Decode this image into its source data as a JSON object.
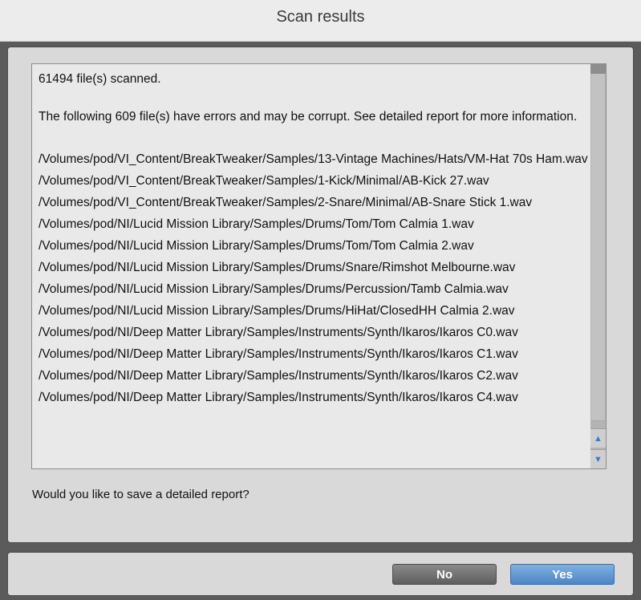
{
  "window": {
    "title": "Scan results"
  },
  "results": {
    "summary": "61494 file(s) scanned.",
    "error_message": "The following 609 file(s) have errors and may be corrupt. See detailed report for more information.",
    "files": [
      "/Volumes/pod/VI_Content/BreakTweaker/Samples/13-Vintage Machines/Hats/VM-Hat 70s Ham.wav",
      "/Volumes/pod/VI_Content/BreakTweaker/Samples/1-Kick/Minimal/AB-Kick 27.wav",
      "/Volumes/pod/VI_Content/BreakTweaker/Samples/2-Snare/Minimal/AB-Snare Stick 1.wav",
      "/Volumes/pod/NI/Lucid Mission Library/Samples/Drums/Tom/Tom Calmia 1.wav",
      "/Volumes/pod/NI/Lucid Mission Library/Samples/Drums/Tom/Tom Calmia 2.wav",
      "/Volumes/pod/NI/Lucid Mission Library/Samples/Drums/Snare/Rimshot Melbourne.wav",
      "/Volumes/pod/NI/Lucid Mission Library/Samples/Drums/Percussion/Tamb Calmia.wav",
      "/Volumes/pod/NI/Lucid Mission Library/Samples/Drums/HiHat/ClosedHH Calmia 2.wav",
      "/Volumes/pod/NI/Deep Matter Library/Samples/Instruments/Synth/Ikaros/Ikaros C0.wav",
      "/Volumes/pod/NI/Deep Matter Library/Samples/Instruments/Synth/Ikaros/Ikaros C1.wav",
      "/Volumes/pod/NI/Deep Matter Library/Samples/Instruments/Synth/Ikaros/Ikaros C2.wav",
      "/Volumes/pod/NI/Deep Matter Library/Samples/Instruments/Synth/Ikaros/Ikaros C4.wav"
    ]
  },
  "prompt": {
    "question": "Would you like to save a detailed report?"
  },
  "buttons": {
    "no": "No",
    "yes": "Yes"
  },
  "scrollbar": {
    "up_icon": "scroll-up-arrow",
    "down_icon": "scroll-down-arrow"
  },
  "colors": {
    "yes_button": "#5a92cf",
    "no_button": "#6e6e6e",
    "panel": "#d9d9d9"
  }
}
